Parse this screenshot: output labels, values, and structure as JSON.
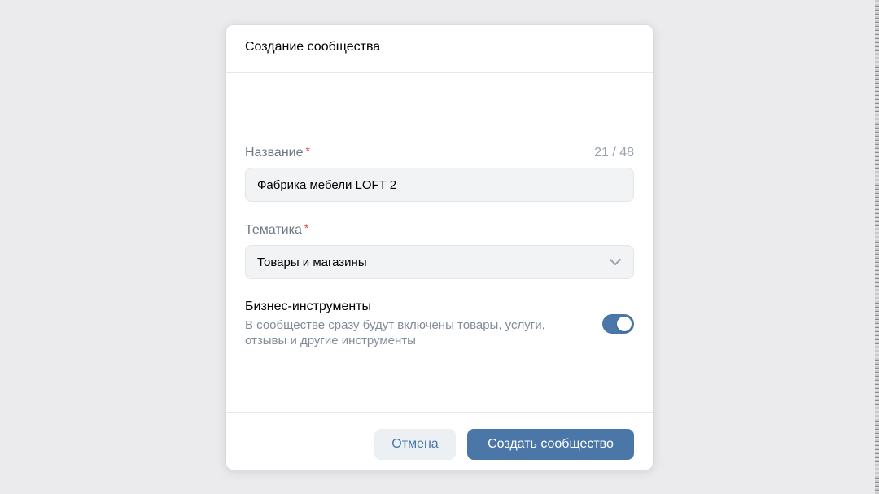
{
  "modal": {
    "title": "Создание сообщества"
  },
  "name_field": {
    "label": "Название",
    "required_mark": "*",
    "counter": "21 / 48",
    "value": "Фабрика мебели LOFT 2"
  },
  "topic_field": {
    "label": "Тематика",
    "required_mark": "*",
    "selected": "Товары и магазины",
    "icon": "chevron-down-icon"
  },
  "business_tools": {
    "title": "Бизнес-инструменты",
    "description": "В сообществе сразу будут включены товары, услуги, отзывы и другие инструменты",
    "enabled": true
  },
  "footer": {
    "cancel_label": "Отмена",
    "create_label": "Создать сообщество"
  },
  "colors": {
    "accent": "#4a76a8",
    "required": "#e64646",
    "background": "#ebebed"
  }
}
